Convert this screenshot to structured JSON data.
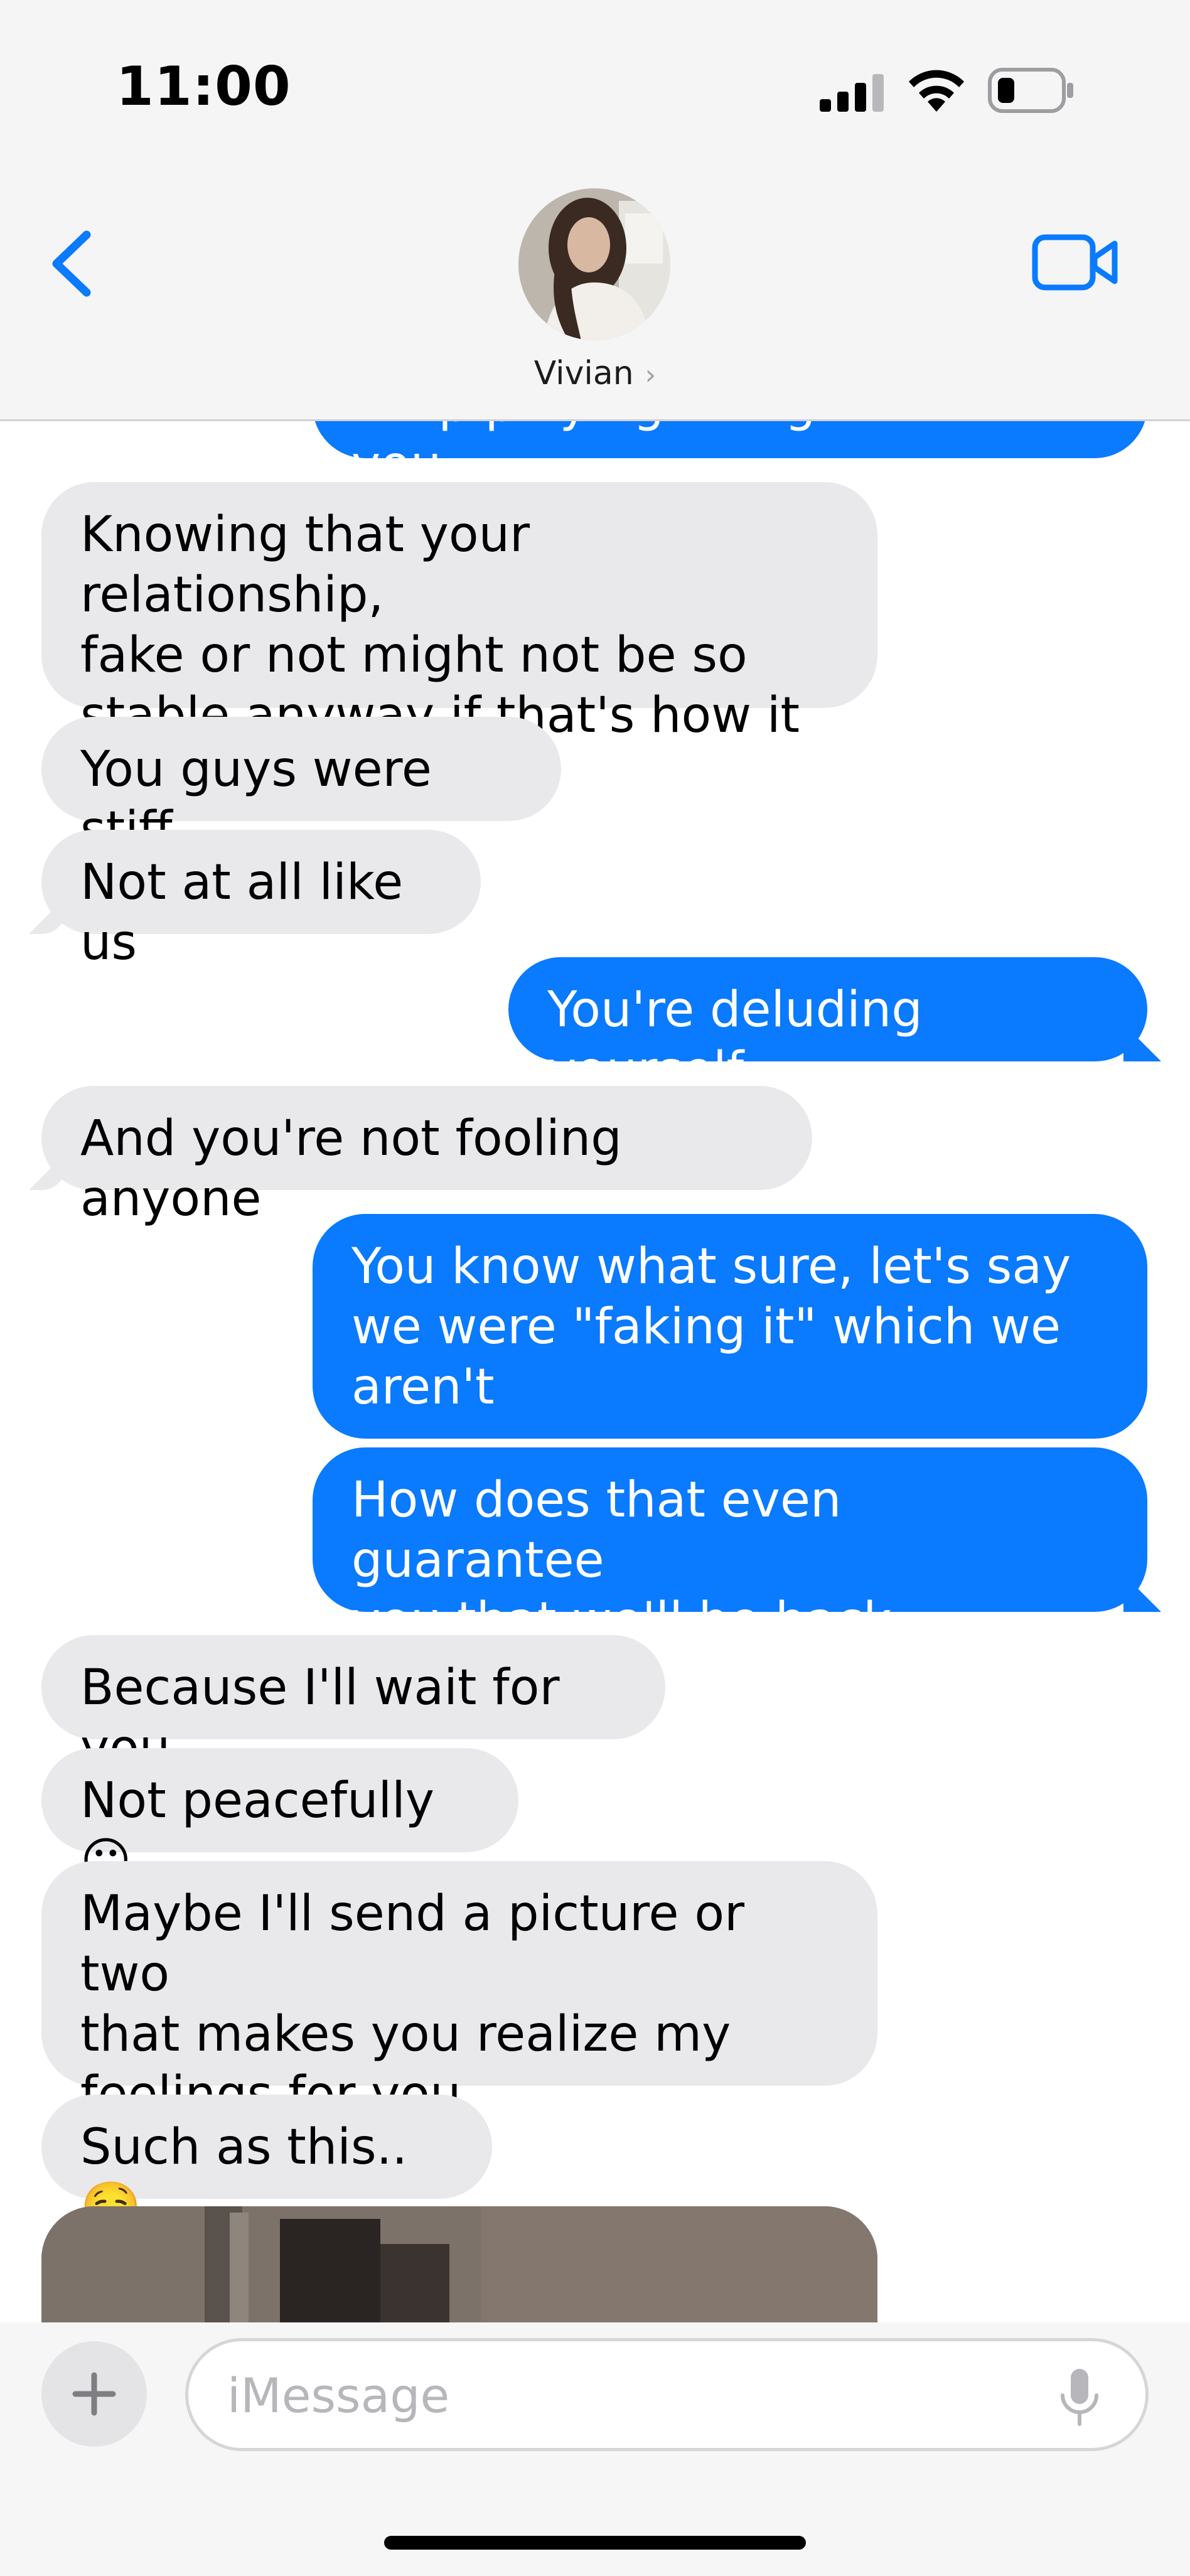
{
  "status_bar": {
    "time": "11:00"
  },
  "header": {
    "contact_name": "Vivian",
    "chevron": "›"
  },
  "messages": [
    {
      "sender": "me",
      "text": "keep playing this game with you"
    },
    {
      "sender": "them",
      "text": "Knowing that your relationship,\nfake or not might not be so\nstable anyway if that's how it is"
    },
    {
      "sender": "them",
      "text": "You guys were stiff"
    },
    {
      "sender": "them",
      "text": "Not at all like us"
    },
    {
      "sender": "me",
      "text": "You're deluding yourself"
    },
    {
      "sender": "them",
      "text": "And you're not fooling anyone"
    },
    {
      "sender": "me",
      "text": "You know what sure, let's say\nwe were \"faking it\" which we\naren't"
    },
    {
      "sender": "me",
      "text": "How does that even guarantee\nyou that we'll be back together?"
    },
    {
      "sender": "them",
      "text": "Because I'll wait for you"
    },
    {
      "sender": "them",
      "text": "Not peacefully 😛"
    },
    {
      "sender": "them",
      "text": "Maybe I'll send a picture or two\nthat makes you realize my\nfeelings for you"
    },
    {
      "sender": "them",
      "text": "Such as this.. 🤤"
    }
  ],
  "composer": {
    "placeholder": "iMessage"
  },
  "icons": {
    "back": "chevron-left-icon",
    "video": "video-camera-icon",
    "plus": "plus-icon",
    "mic": "microphone-icon",
    "signal": "cellular-signal-icon",
    "wifi": "wifi-icon",
    "battery": "battery-icon"
  },
  "colors": {
    "accent": "#0a7aff",
    "incoming_bubble": "#e9e9eb",
    "header_bg": "#f5f5f5"
  }
}
